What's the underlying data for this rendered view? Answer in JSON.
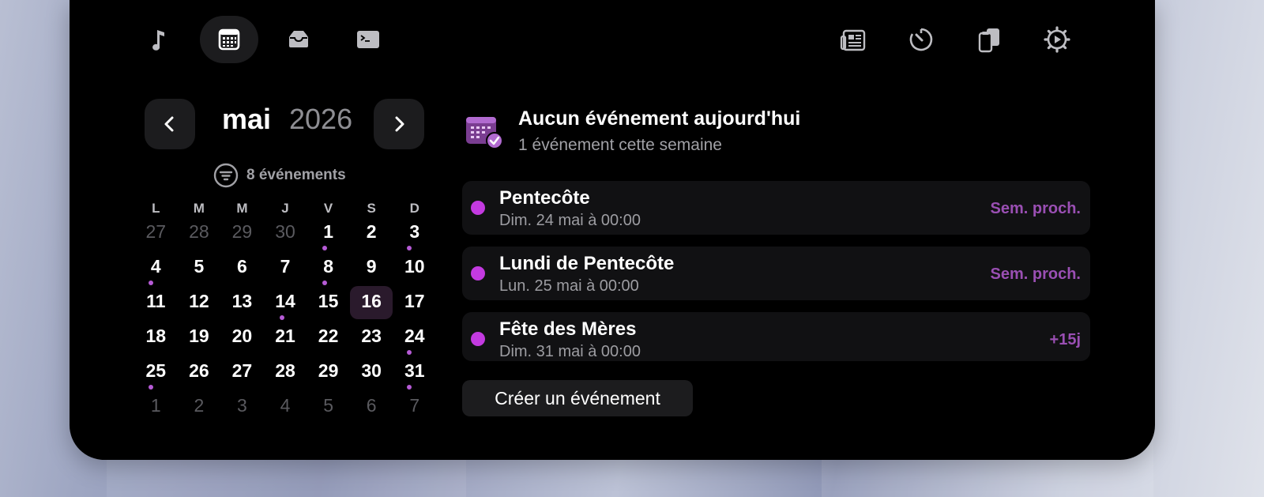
{
  "toolbar": {
    "left": [
      {
        "name": "music-icon",
        "active": false
      },
      {
        "name": "calendar-icon",
        "active": true
      },
      {
        "name": "tray-icon",
        "active": false
      },
      {
        "name": "terminal-icon",
        "active": false
      }
    ],
    "right": [
      {
        "name": "news-icon"
      },
      {
        "name": "timer-icon"
      },
      {
        "name": "clipboard-icon"
      },
      {
        "name": "settings-icon"
      }
    ]
  },
  "calendar": {
    "month": "mai",
    "year": "2026",
    "filter_label": "8 événements",
    "weekdays": [
      "L",
      "M",
      "M",
      "J",
      "V",
      "S",
      "D"
    ],
    "weeks": [
      [
        {
          "d": "27",
          "m": true
        },
        {
          "d": "28",
          "m": true
        },
        {
          "d": "29",
          "m": true
        },
        {
          "d": "30",
          "m": true
        },
        {
          "d": "1",
          "dot": true
        },
        {
          "d": "2"
        },
        {
          "d": "3",
          "dot": true
        }
      ],
      [
        {
          "d": "4",
          "dot": true
        },
        {
          "d": "5"
        },
        {
          "d": "6"
        },
        {
          "d": "7"
        },
        {
          "d": "8",
          "dot": true
        },
        {
          "d": "9"
        },
        {
          "d": "10"
        }
      ],
      [
        {
          "d": "11"
        },
        {
          "d": "12"
        },
        {
          "d": "13"
        },
        {
          "d": "14",
          "dot": true
        },
        {
          "d": "15"
        },
        {
          "d": "16",
          "today": true
        },
        {
          "d": "17"
        }
      ],
      [
        {
          "d": "18"
        },
        {
          "d": "19"
        },
        {
          "d": "20"
        },
        {
          "d": "21"
        },
        {
          "d": "22"
        },
        {
          "d": "23"
        },
        {
          "d": "24",
          "dot": true
        }
      ],
      [
        {
          "d": "25",
          "dot": true
        },
        {
          "d": "26"
        },
        {
          "d": "27"
        },
        {
          "d": "28"
        },
        {
          "d": "29"
        },
        {
          "d": "30"
        },
        {
          "d": "31",
          "dot": true
        }
      ],
      [
        {
          "d": "1",
          "m": true
        },
        {
          "d": "2",
          "m": true
        },
        {
          "d": "3",
          "m": true
        },
        {
          "d": "4",
          "m": true
        },
        {
          "d": "5",
          "m": true
        },
        {
          "d": "6",
          "m": true
        },
        {
          "d": "7",
          "m": true
        }
      ]
    ]
  },
  "summary": {
    "title": "Aucun événement aujourd'hui",
    "subtitle": "1 événement cette semaine"
  },
  "events": [
    {
      "title": "Pentecôte",
      "date": "Dim. 24 mai à 00:00",
      "tag": "Sem. proch."
    },
    {
      "title": "Lundi de Pentecôte",
      "date": "Lun. 25 mai à 00:00",
      "tag": "Sem. proch."
    },
    {
      "title": "Fête des Mères",
      "date": "Dim. 31 mai à 00:00",
      "tag": "+15j"
    }
  ],
  "create_button": "Créer un événement",
  "colors": {
    "accent": "#c33ae0",
    "dot": "#b65bd6",
    "tag": "#9a4fb3",
    "today_bg": "#2a1a2c",
    "panel": "#000000"
  }
}
